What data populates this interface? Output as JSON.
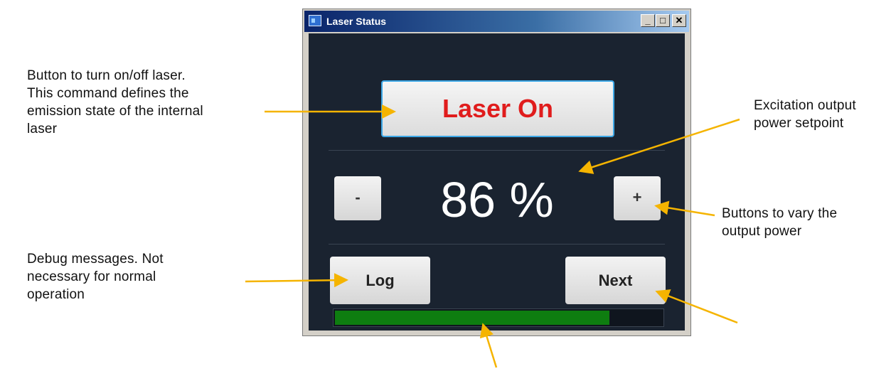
{
  "window": {
    "title": "Laser Status",
    "controls": {
      "minimize": "_",
      "maximize": "□",
      "close": "✕"
    }
  },
  "laser_button": {
    "label": "Laser On",
    "color": "#e01c1c"
  },
  "power": {
    "minus_label": "-",
    "value": "86 %",
    "plus_label": "+"
  },
  "buttons": {
    "log_label": "Log",
    "next_label": "Next"
  },
  "progress": {
    "fraction": 0.84,
    "color": "#0e7d10"
  },
  "annotations": {
    "laser_button": [
      "Button to turn on/off laser.",
      "This command defines the",
      "emission state of the internal",
      "laser"
    ],
    "setpoint": [
      "Excitation output",
      "power setpoint"
    ],
    "power_buttons": [
      "Buttons to vary the",
      "output power"
    ],
    "debug": [
      "Debug messages.  Not",
      "necessary for normal",
      "operation"
    ],
    "arrow_color": "#f5b400"
  }
}
